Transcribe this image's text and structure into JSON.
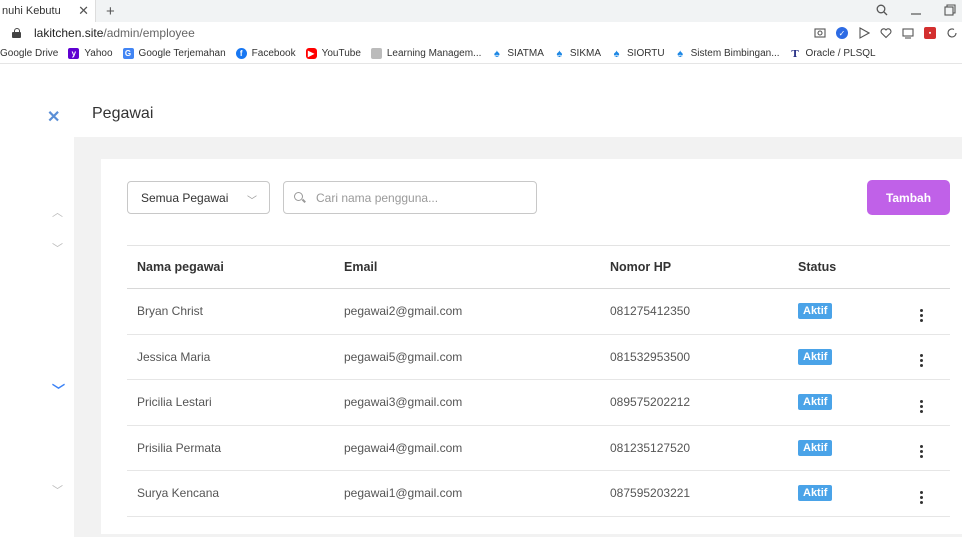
{
  "browser": {
    "tab_title": "nuhi Kebutu",
    "tab_close": "✕",
    "new_tab": "+",
    "url_domain": "lakitchen.site",
    "url_path": "/admin/employee",
    "bookmarks": [
      {
        "label": "Google Drive",
        "icon": "drive-icon"
      },
      {
        "label": "Yahoo",
        "icon": "yahoo-icon"
      },
      {
        "label": "Google Terjemahan",
        "icon": "translate-icon"
      },
      {
        "label": "Facebook",
        "icon": "facebook-icon"
      },
      {
        "label": "YouTube",
        "icon": "youtube-icon"
      },
      {
        "label": "Learning Managem...",
        "icon": "lms-icon"
      },
      {
        "label": "SIATMA",
        "icon": "uni-icon"
      },
      {
        "label": "SIKMA",
        "icon": "uni-icon"
      },
      {
        "label": "SIORTU",
        "icon": "uni-icon"
      },
      {
        "label": "Sistem Bimbingan...",
        "icon": "uni-icon"
      },
      {
        "label": "Oracle / PLSQL",
        "icon": "oracle-icon"
      }
    ]
  },
  "header": {
    "close_glyph": "✕",
    "title": "Pegawai"
  },
  "toolbar": {
    "filter_value": "Semua Pegawai",
    "search_placeholder": "Cari nama pengguna...",
    "add_label": "Tambah"
  },
  "table": {
    "columns": [
      "Nama pegawai",
      "Email",
      "Nomor HP",
      "Status"
    ],
    "rows": [
      {
        "name": "Bryan Christ",
        "email": "pegawai2@gmail.com",
        "phone": "081275412350",
        "status": "Aktif"
      },
      {
        "name": "Jessica Maria",
        "email": "pegawai5@gmail.com",
        "phone": "081532953500",
        "status": "Aktif"
      },
      {
        "name": "Pricilia Lestari",
        "email": "pegawai3@gmail.com",
        "phone": "089575202212",
        "status": "Aktif"
      },
      {
        "name": "Prisilia Permata",
        "email": "pegawai4@gmail.com",
        "phone": "081235127520",
        "status": "Aktif"
      },
      {
        "name": "Surya Kencana",
        "email": "pegawai1@gmail.com",
        "phone": "087595203221",
        "status": "Aktif"
      }
    ]
  },
  "colors": {
    "accent_button": "#c061e8",
    "status_badge": "#4aa3e8",
    "close_icon": "#5b8fd6"
  }
}
